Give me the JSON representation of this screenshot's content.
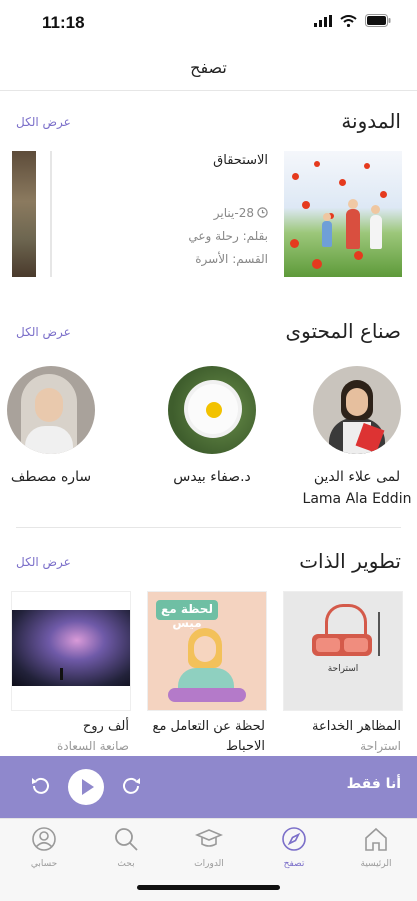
{
  "status": {
    "time": "11:18"
  },
  "nav": {
    "title": "تصفح"
  },
  "blog": {
    "title": "المدونة",
    "see_all": "عرض الكل",
    "card": {
      "title": "الاستحقاق",
      "date": "28-يناير",
      "author": "بقلم: رحلة وعي",
      "category": "القسم: الأسرة"
    }
  },
  "creators": {
    "title": "صناع المحتوى",
    "see_all": "عرض الكل",
    "items": [
      {
        "name": "لمى علاء الدين",
        "name_en": "Lama Ala Eddin"
      },
      {
        "name": "د.صفاء بيدس"
      },
      {
        "name": "ساره مصطف"
      }
    ]
  },
  "self_dev": {
    "title": "تطوير الذات",
    "see_all": "عرض الكل",
    "items": [
      {
        "title": "المظاهر الخداعة",
        "sub": "استراحة",
        "cover_text": "استراحة"
      },
      {
        "title": "لحظة عن التعامل مع الاحباط",
        "sub": "",
        "cover_text": "لحظة مع ميس"
      },
      {
        "title": "ألف روح",
        "sub": "صانعة السعادة",
        "cover_text": ""
      }
    ]
  },
  "player": {
    "title": "أنا فقط"
  },
  "tabs": [
    {
      "label": "الرئيسية",
      "icon": "home-icon"
    },
    {
      "label": "تصفح",
      "icon": "compass-icon",
      "active": true
    },
    {
      "label": "الدورات",
      "icon": "graduation-cap-icon"
    },
    {
      "label": "بحث",
      "icon": "search-icon"
    },
    {
      "label": "حسابي",
      "icon": "user-icon"
    }
  ],
  "colors": {
    "accent": "#7b6fc9",
    "player_bg": "#8f88cc"
  }
}
